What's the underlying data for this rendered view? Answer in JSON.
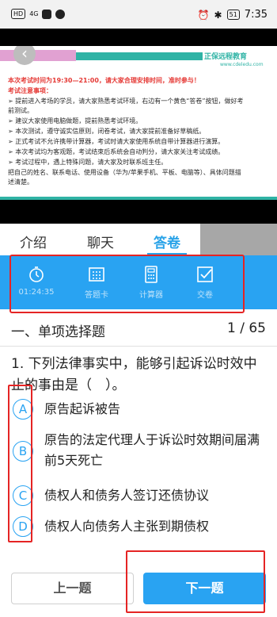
{
  "status_bar": {
    "network": "HD",
    "signal": "4G",
    "battery": "51",
    "time": "7:35"
  },
  "video": {
    "logo_text": "正保远程教育",
    "logo_sub": "www.cdeledu.com",
    "exam_time_notice": "本次考试时间为19:30—21:00，请大家合理安排时间，准时参与！",
    "notes_heading": "考试注意事项：",
    "notes": [
      "➢ 提前进入考场的学员，请大家熟悉考试环境，右边有一个黄色“答卷”按钮，做好考前测试。",
      "➢ 建议大家使用电脑做题，提前熟悉考试环境。",
      "➢ 本次测试，遵守诚实信原则，闭卷考试，请大家提前准备好草稿纸。",
      "➢ 正式考试不允许携带计算器，考试时请大家使用系统自带计算器进行演算。",
      "➢ 本次考试均为客观题，考试结束后系统会自动判分，请大家关注考试成绩。",
      "➢ 考试过程中，遇上特殊问题，请大家及时联系班主任。",
      "把自己的姓名、联系电话、使用设备（华为/苹果手机、平板、电脑等）、具体问题描述清楚。"
    ]
  },
  "tabs": [
    {
      "label": "介绍"
    },
    {
      "label": "聊天"
    },
    {
      "label": "答卷"
    }
  ],
  "toolbar": {
    "timer": "01:24:35",
    "answer_card": "答题卡",
    "calculator": "计算器",
    "submit": "交卷"
  },
  "section": {
    "title": "一、单项选择题",
    "progress": "1 / 65"
  },
  "question": {
    "text": "1. 下列法律事实中，能够引起诉讼时效中止的事由是（　）。",
    "options": [
      {
        "letter": "A",
        "text": "原告起诉被告"
      },
      {
        "letter": "B",
        "text": "原告的法定代理人于诉讼时效期间届满前5天死亡"
      },
      {
        "letter": "C",
        "text": "债权人和债务人签订还债协议"
      },
      {
        "letter": "D",
        "text": "债权人向债务人主张到期债权"
      }
    ]
  },
  "nav": {
    "prev": "上一题",
    "next": "下一题"
  },
  "colors": {
    "accent": "#29a3f2",
    "highlight_box": "#e52424",
    "brand_teal": "#2fb3a5"
  }
}
